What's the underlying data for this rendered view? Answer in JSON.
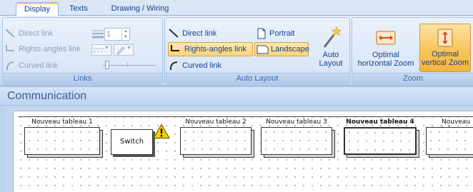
{
  "tabs": [
    {
      "label": "Display",
      "active": true
    },
    {
      "label": "Texts",
      "active": false
    },
    {
      "label": "Drawing / Wiring",
      "active": false
    }
  ],
  "ribbon": {
    "links_group": {
      "label": "Links",
      "direct_link": "Direct link",
      "rights_angles_link": "Rights-angles link",
      "curved_link": "Curved link",
      "line_width_value": "1"
    },
    "auto_layout_group": {
      "label": "Auto Layout",
      "direct_link": "Direct link",
      "rights_angles_link": "Rights-angles link",
      "curved_link": "Curved link",
      "portrait": "Portrait",
      "landscape": "Landscape",
      "auto_layout_line1": "Auto",
      "auto_layout_line2": "Layout"
    },
    "zoom_group": {
      "label": "Zoom",
      "optimal_horizontal_line1": "Optimal",
      "optimal_horizontal_line2": "horizontal Zoom",
      "optimal_vertical_line1": "Optimal",
      "optimal_vertical_line2": "vertical Zoom"
    }
  },
  "document": {
    "title": "Communication",
    "boards": [
      {
        "title": "Nouveau tableau 1",
        "bold": false
      },
      {
        "title": "Nouveau tableau 2",
        "bold": false
      },
      {
        "title": "Nouveau tableau 3",
        "bold": false
      },
      {
        "title": "Nouveau tableau 4",
        "bold": true
      },
      {
        "title": "Nouveau tab",
        "bold": false
      }
    ],
    "switch_label": "Switch"
  },
  "colors": {
    "pressed_button": "#fbd27a",
    "ribbon_text": "#15428b",
    "warning": "#f5d300"
  }
}
